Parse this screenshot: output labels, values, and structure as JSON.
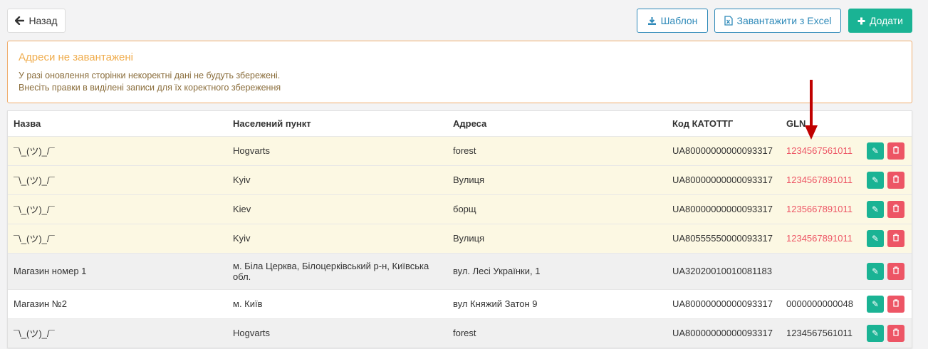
{
  "toolbar": {
    "back_label": "Назад",
    "template_label": "Шаблон",
    "excel_label": "Завантажити з Excel",
    "add_label": "Додати"
  },
  "alert": {
    "title": "Адреси не завантажені",
    "line1": "У разі оновлення сторінки некоректні дані не будуть збережені.",
    "line2": "Внесіть правки в виділені записи для їх коректного збереження"
  },
  "table": {
    "headers": [
      "Назва",
      "Населений пункт",
      "Адреса",
      "Код КАТОТТГ",
      "GLN"
    ],
    "rows": [
      {
        "name": "¯\\_(ツ)_/¯",
        "city": "Hogvarts",
        "address": "forest",
        "code": "UA80000000000093317",
        "gln": "1234567561011"
      },
      {
        "name": "¯\\_(ツ)_/¯",
        "city": "Kyiv",
        "address": "Вулиця",
        "code": "UA80000000000093317",
        "gln": "1234567891011"
      },
      {
        "name": "¯\\_(ツ)_/¯",
        "city": "Kiev",
        "address": "борщ",
        "code": "UA80000000000093317",
        "gln": "1235667891011"
      },
      {
        "name": "¯\\_(ツ)_/¯",
        "city": "Kyiv",
        "address": "Вулиця",
        "code": "UA80555550000093317",
        "gln": "1234567891011"
      },
      {
        "name": "Магазин номер 1",
        "city": "м. Біла Церква, Білоцерківський р-н, Київська обл.",
        "address": "вул. Лесі Українки, 1",
        "code": "UA32020010010081183",
        "gln": ""
      },
      {
        "name": "Магазин №2",
        "city": "м. Київ",
        "address": "вул Княжий Затон 9",
        "code": "UA80000000000093317",
        "gln": "0000000000048"
      },
      {
        "name": "¯\\_(ツ)_/¯",
        "city": "Hogvarts",
        "address": "forest",
        "code": "UA80000000000093317",
        "gln": "1234567561011"
      }
    ]
  },
  "colors": {
    "accent_green": "#1ab394",
    "accent_blue": "#2f8ab9",
    "danger": "#ed5565",
    "warning": "#f0ad4e",
    "warning_row": "#fcf8e3",
    "annotation_arrow": "#c00000"
  }
}
